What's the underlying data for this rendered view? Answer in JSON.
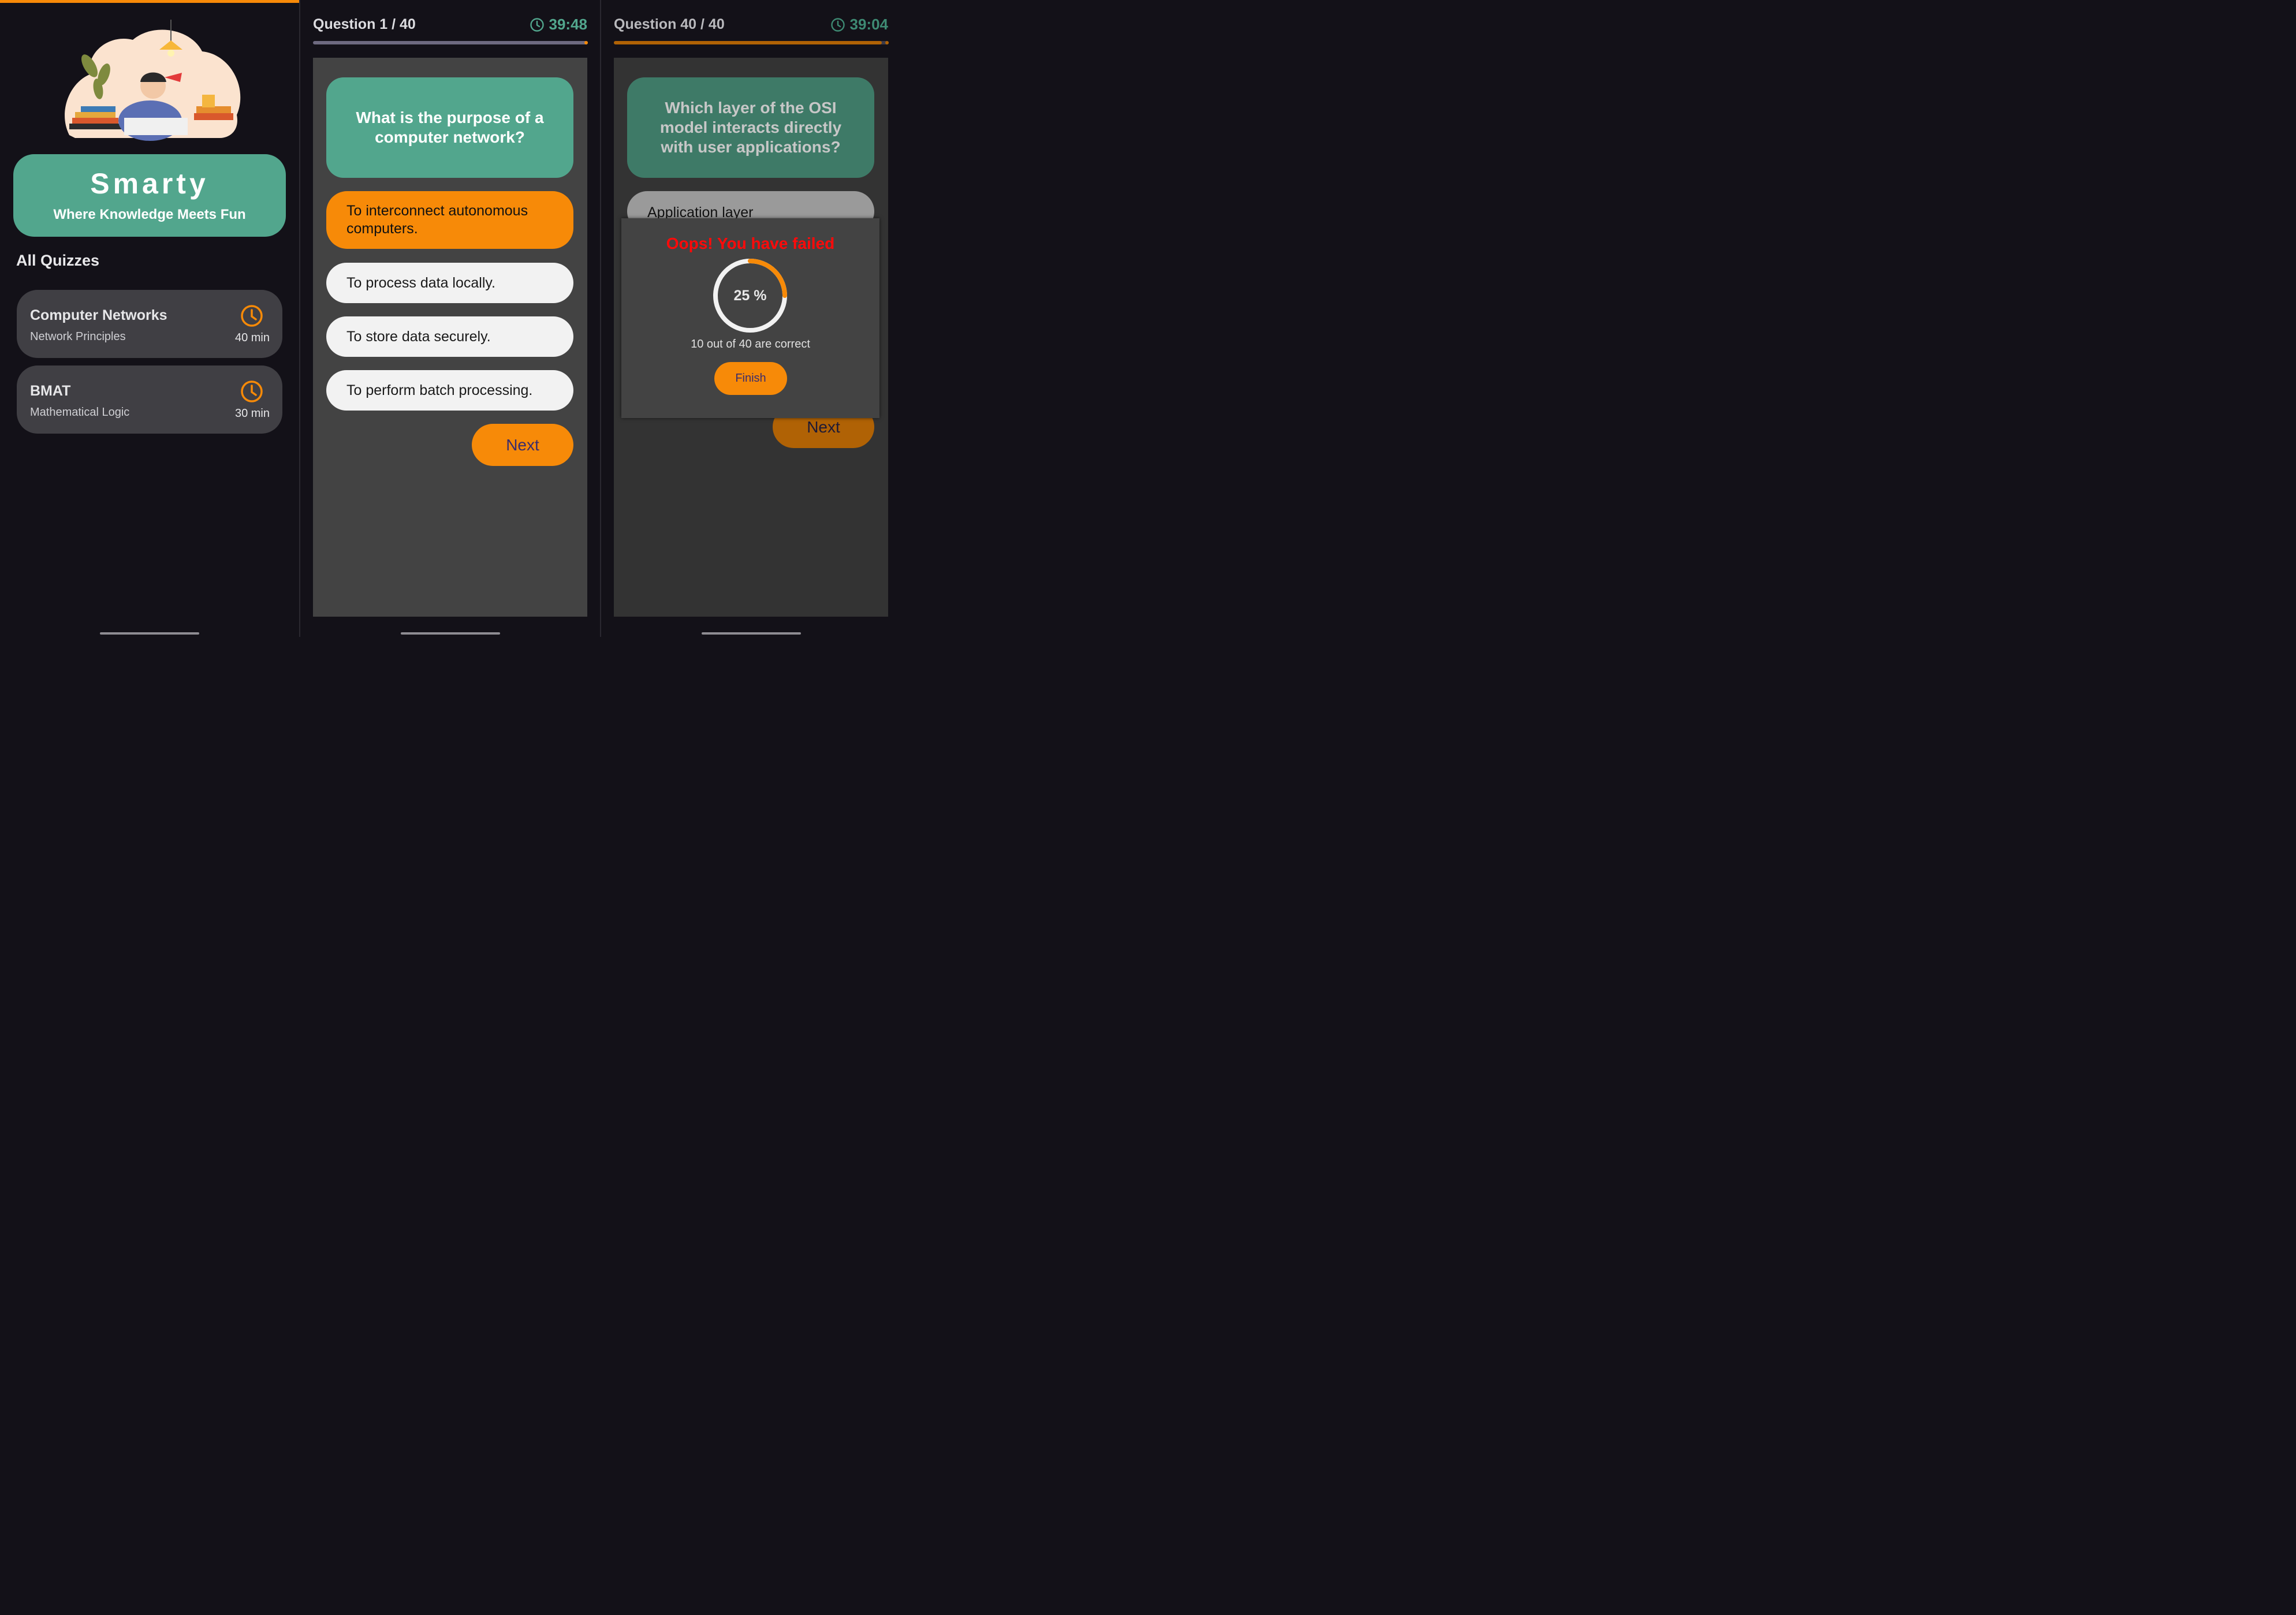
{
  "colors": {
    "accent": "#f78a08",
    "teal": "#52a68d",
    "background": "#131118",
    "card": "#403f44",
    "fail": "#ff0a0a"
  },
  "home": {
    "app_title": "Smarty",
    "tagline": "Where Knowledge Meets Fun",
    "section_title": "All Quizzes",
    "quizzes": [
      {
        "name": "Computer Networks",
        "subtitle": "Network Principles",
        "duration": "40 min",
        "icon": "clock-icon"
      },
      {
        "name": "BMAT",
        "subtitle": "Mathematical Logic",
        "duration": "30 min",
        "icon": "clock-icon"
      }
    ]
  },
  "quiz_start": {
    "counter": "Question 1 / 40",
    "timer": "39:48",
    "progress": 0.0,
    "question": "What is the purpose of a computer network?",
    "options": [
      {
        "text": "To interconnect autonomous computers.",
        "selected": true
      },
      {
        "text": "To process data locally.",
        "selected": false
      },
      {
        "text": "To store data securely.",
        "selected": false
      },
      {
        "text": "To perform batch processing.",
        "selected": false
      }
    ],
    "next_label": "Next"
  },
  "quiz_end": {
    "counter": "Question 40 / 40",
    "timer": "39:04",
    "progress": 0.975,
    "question": "Which layer of the OSI model interacts directly with user applications?",
    "visible_option": "Application layer",
    "next_label": "Next",
    "result": {
      "title": "Oops! You have failed",
      "percent_label": "25 %",
      "percent": 25,
      "summary": "10 out of 40 are correct",
      "finish_label": "Finish"
    }
  }
}
